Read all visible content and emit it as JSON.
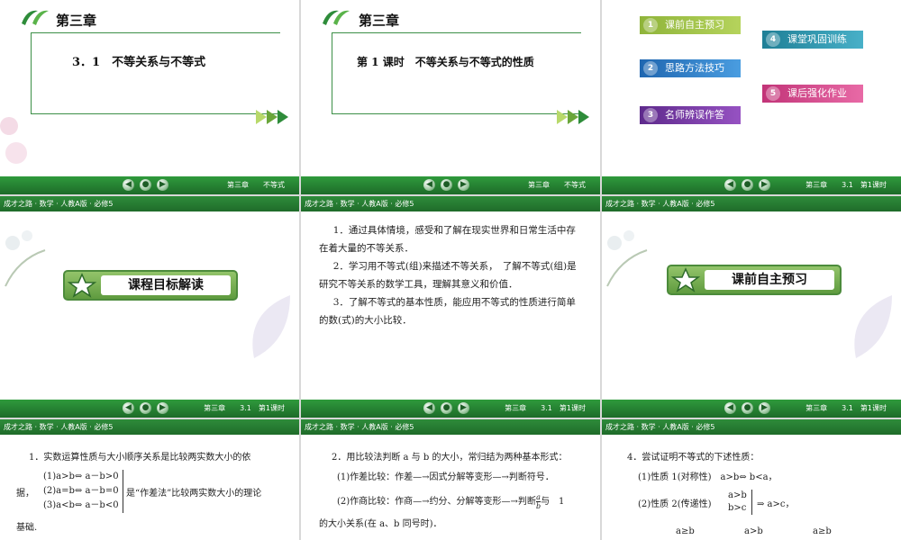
{
  "common": {
    "header": "成才之路 · 数学 · 人教A版 · 必修5",
    "footer_chapter": "第三章",
    "footer_topic": "不等式",
    "footer_section": "3.1",
    "footer_lesson": "第1课时"
  },
  "slide1": {
    "chapter": "第三章",
    "title": "3．1　不等关系与不等式"
  },
  "slide2": {
    "chapter": "第三章",
    "title": "第 1 课时　不等关系与不等式的性质"
  },
  "slide3": {
    "menu": [
      {
        "num": "1",
        "label": "课前自主预习",
        "color": "#8fb43a"
      },
      {
        "num": "2",
        "label": "思路方法技巧",
        "color": "#2f7fc8"
      },
      {
        "num": "3",
        "label": "名师辨误作答",
        "color": "#7b3fa6"
      },
      {
        "num": "4",
        "label": "课堂巩固训练",
        "color": "#2a8fa8"
      },
      {
        "num": "5",
        "label": "课后强化作业",
        "color": "#d2468a"
      }
    ]
  },
  "slide4": {
    "banner": "课程目标解读"
  },
  "slide5": {
    "items": [
      "1．通过具体情境，感受和了解在现实世界和日常生活中存在着大量的不等关系．",
      "2．学习用不等式(组)来描述不等关系，　了解不等式(组)是研究不等关系的数学工具，理解其意义和价值．",
      "3．了解不等式的基本性质，能应用不等式的性质进行简单的数(式)的大小比较．"
    ]
  },
  "slide6": {
    "banner": "课前自主预习"
  },
  "slide7": {
    "intro": "1．实数运算性质与大小顺序关系是比较两实数大小的依",
    "lines": [
      "(1)a>b⇔ a－b>0",
      "(2)a=b⇔ a－b=0",
      "(3)a<b⇔ a－b<0"
    ],
    "left_label": "据，",
    "right_label": "是“作差法”比较两实数大小的理论",
    "tail": "基础."
  },
  "slide8": {
    "intro": "2．用比较法判断 a 与 b 的大小，常归结为两种基本形式：",
    "l1": "(1)作差比较：作差—→因式分解等变形—→判断符号．",
    "l2a": "(2)作商比较：作商—→约分、分解等变形—→判断",
    "frac_num": "a",
    "frac_den": "b",
    "l2b": "与　1",
    "l3": "的大小关系(在 a、b 同号时)．"
  },
  "slide9": {
    "intro": "4．尝试证明不等式的下述性质：",
    "p1": "(1)性质 1(对称性)　a>b⇔ b<a，",
    "p2": "(2)性质 2(传递性)",
    "p2a": "a>b",
    "p2b": "b>c",
    "p2c": "⇒ a>c，",
    "p3a": "a≥b",
    "p3b": "a>b",
    "p3c": "a≥b"
  }
}
